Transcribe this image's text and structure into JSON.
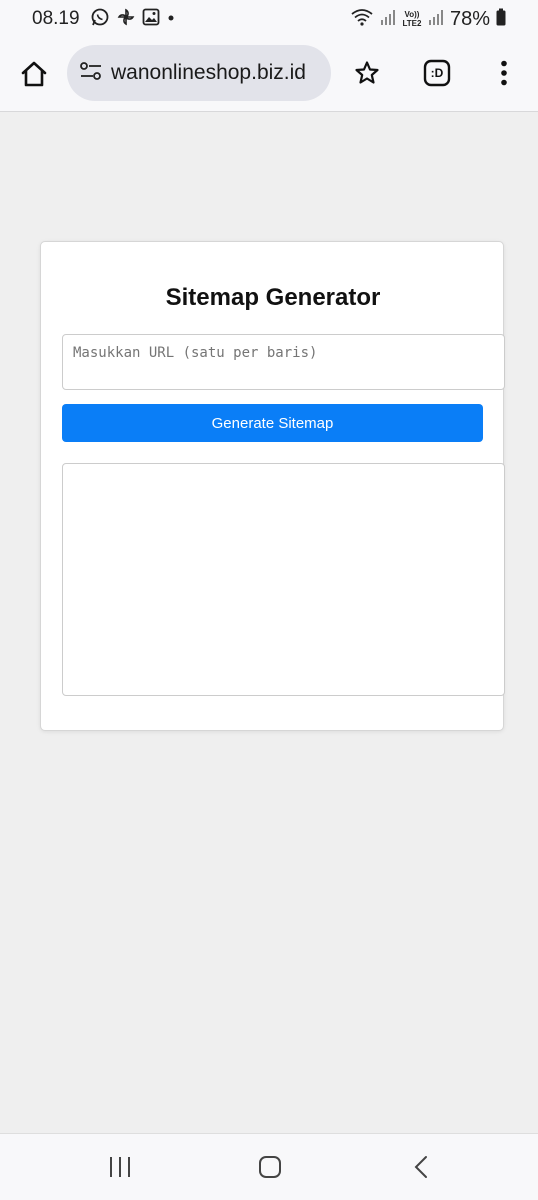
{
  "status_bar": {
    "time": "08.19",
    "network_label": "Vo)) LTE2",
    "battery": "78%"
  },
  "browser": {
    "url": "wanonlineshop.biz.id",
    "extension_label": ":D"
  },
  "page": {
    "title": "Sitemap Generator",
    "url_input_placeholder": "Masukkan URL (satu per baris)",
    "url_input_value": "",
    "generate_button_label": "Generate Sitemap",
    "output_value": ""
  },
  "colors": {
    "primary_button": "#0a7ef7",
    "page_background": "#efefef",
    "card_background": "#ffffff"
  },
  "icons": {
    "status": [
      "whatsapp-icon",
      "pinwheel-icon",
      "gallery-icon",
      "dot-icon",
      "wifi-icon",
      "signal-icon",
      "battery-icon"
    ],
    "toolbar": [
      "home-icon",
      "site-settings-icon",
      "star-icon",
      "extension-icon",
      "more-vert-icon"
    ],
    "nav": [
      "recent-apps-icon",
      "home-nav-icon",
      "back-icon"
    ]
  }
}
